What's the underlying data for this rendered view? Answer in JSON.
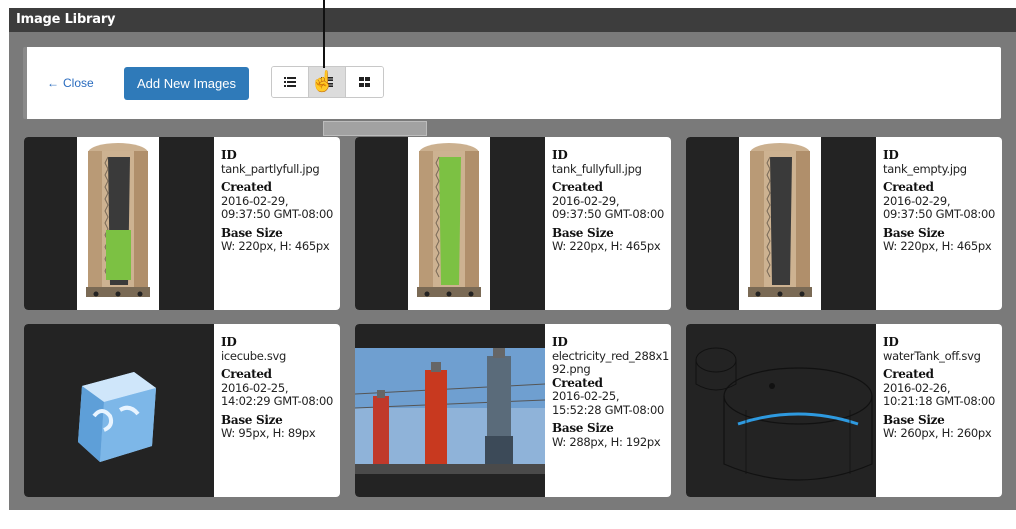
{
  "window": {
    "title": "Image Library"
  },
  "toolbar": {
    "close_label": "Close",
    "add_label": "Add New Images",
    "views": [
      "list-view-icon",
      "detail-view-icon",
      "grid-view-icon"
    ],
    "active_view": "detail-view-icon"
  },
  "labels": {
    "id": "ID",
    "created": "Created",
    "base_size": "Base Size"
  },
  "images": [
    {
      "id": "tank_partlyfull.jpg",
      "created_date": "2016-02-29,",
      "created_time": "09:37:50 GMT-08:00",
      "size": "W: 220px, H: 465px",
      "thumb": "tank-partly-full"
    },
    {
      "id": "tank_fullyfull.jpg",
      "created_date": "2016-02-29,",
      "created_time": "09:37:50 GMT-08:00",
      "size": "W: 220px, H: 465px",
      "thumb": "tank-fully-full"
    },
    {
      "id": "tank_empty.jpg",
      "created_date": "2016-02-29,",
      "created_time": "09:37:50 GMT-08:00",
      "size": "W: 220px, H: 465px",
      "thumb": "tank-empty"
    },
    {
      "id": "icecube.svg",
      "created_date": "2016-02-25,",
      "created_time": "14:02:29 GMT-08:00",
      "size": "W: 95px, H: 89px",
      "thumb": "ice-cube"
    },
    {
      "id_line1": "electricity_red_288x1",
      "id_line2": "92.png",
      "created_date": "2016-02-25,",
      "created_time": "15:52:28 GMT-08:00",
      "size": "W: 288px, H: 192px",
      "thumb": "electricity-insulators"
    },
    {
      "id": "waterTank_off.svg",
      "created_date": "2016-02-26,",
      "created_time": "10:21:18 GMT-08:00",
      "size": "W: 260px, H: 260px",
      "thumb": "water-tank-off"
    }
  ],
  "colors": {
    "accent": "#2f7ab9",
    "titlebar": "#3d3d3d",
    "backdrop": "#7a7a7a",
    "tank_fill": "#7cc143"
  }
}
